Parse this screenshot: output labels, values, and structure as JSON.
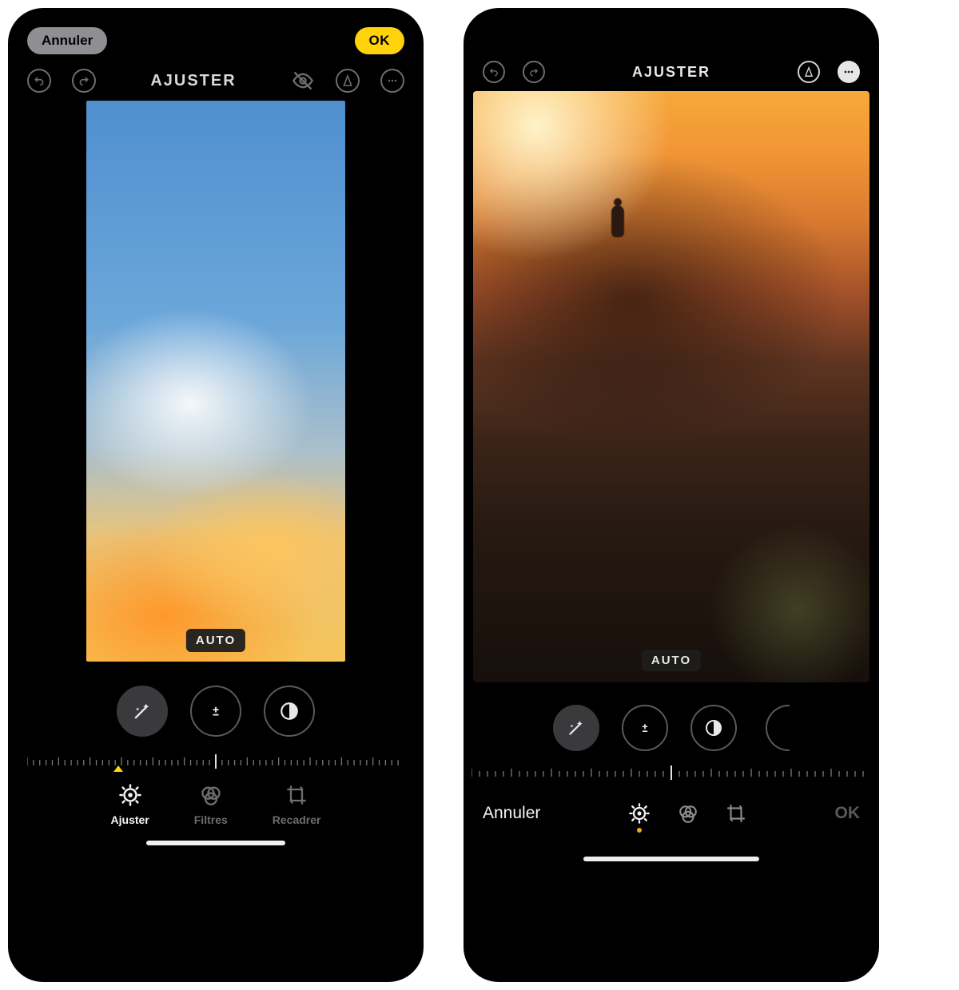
{
  "phoneA": {
    "top": {
      "cancel": "Annuler",
      "ok": "OK"
    },
    "toolbar": {
      "title": "AJUSTER",
      "icons": {
        "undo": "undo-icon",
        "redo": "redo-icon",
        "visibility": "eye-off-icon",
        "markup": "markup-icon",
        "more": "more-icon"
      }
    },
    "canvas": {
      "auto_label": "AUTO"
    },
    "adjust": {
      "items": [
        {
          "id": "magic",
          "icon": "wand-icon",
          "active": true
        },
        {
          "id": "exposure",
          "icon": "exposure-icon",
          "active": false
        },
        {
          "id": "brightness",
          "icon": "yinyang-icon",
          "active": false
        }
      ]
    },
    "tabs": {
      "items": [
        {
          "id": "adjust",
          "label": "Ajuster",
          "icon": "adjust-dial-icon",
          "active": true
        },
        {
          "id": "filters",
          "label": "Filtres",
          "icon": "filters-icon",
          "active": false
        },
        {
          "id": "crop",
          "label": "Recadrer",
          "icon": "crop-icon",
          "active": false
        }
      ]
    }
  },
  "phoneB": {
    "toolbar": {
      "title": "AJUSTER",
      "icons": {
        "undo": "undo-icon",
        "redo": "redo-icon",
        "markup": "markup-icon",
        "more": "more-icon"
      }
    },
    "canvas": {
      "auto_label": "AUTO"
    },
    "adjust": {
      "items": [
        {
          "id": "magic",
          "icon": "wand-icon",
          "active": true
        },
        {
          "id": "exposure",
          "icon": "exposure-icon",
          "active": false
        },
        {
          "id": "brightness",
          "icon": "yinyang-icon",
          "active": false
        },
        {
          "id": "next",
          "icon": "partial-icon",
          "active": false
        }
      ]
    },
    "bottom": {
      "cancel": "Annuler",
      "ok": "OK",
      "tabs": [
        {
          "id": "adjust",
          "icon": "adjust-dial-icon",
          "active": true
        },
        {
          "id": "filters",
          "icon": "filters-icon",
          "active": false
        },
        {
          "id": "crop",
          "icon": "crop-icon",
          "active": false
        }
      ]
    }
  }
}
